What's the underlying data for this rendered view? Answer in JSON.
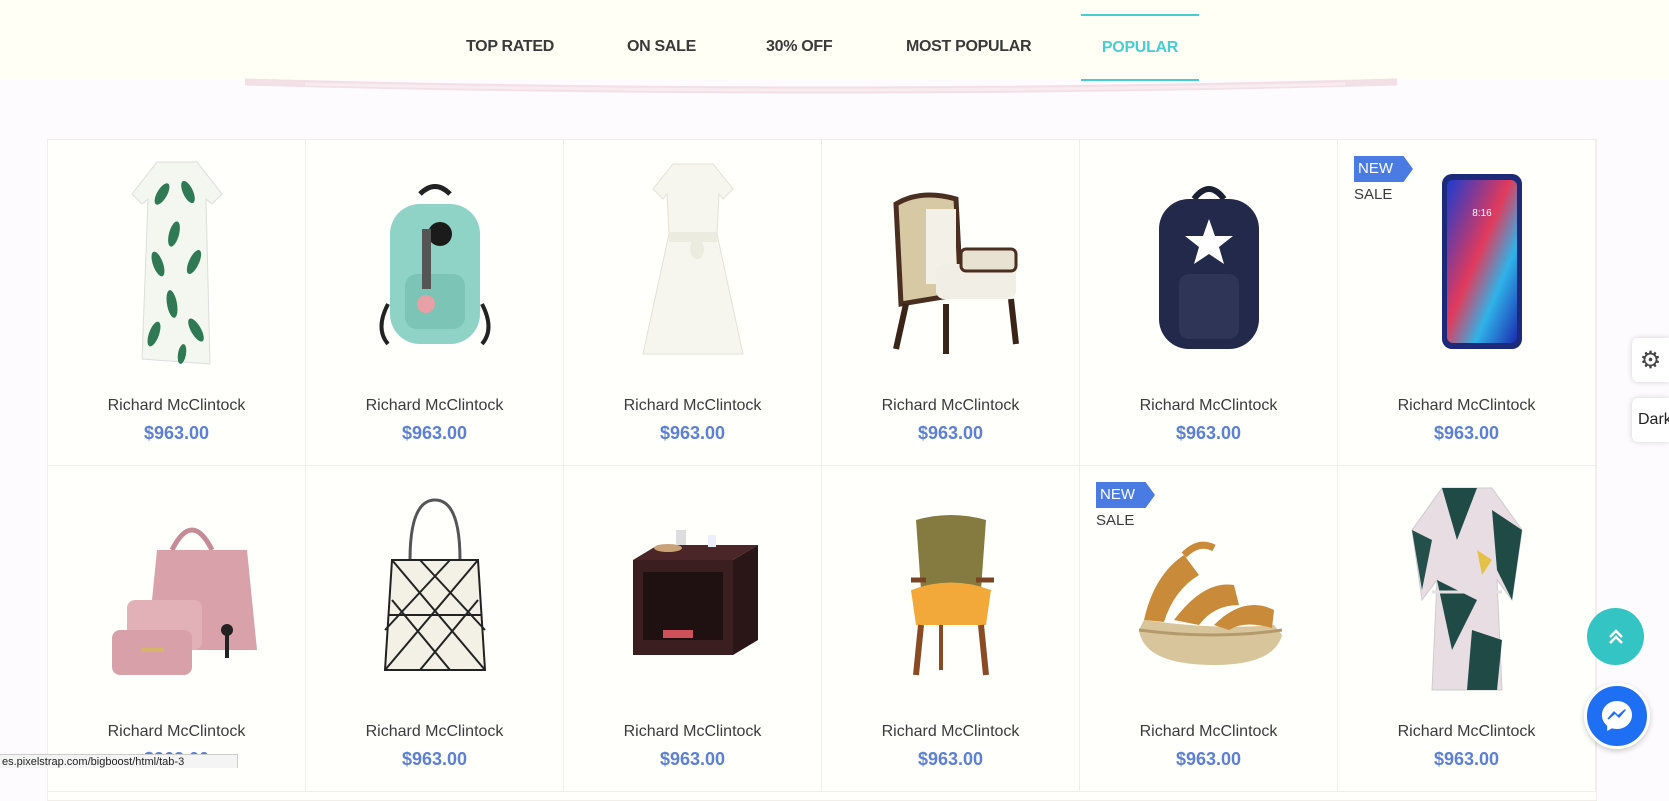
{
  "tabs": [
    {
      "label": "TOP RATED",
      "active": false
    },
    {
      "label": "ON SALE",
      "active": false
    },
    {
      "label": "30% OFF",
      "active": false
    },
    {
      "label": "MOST POPULAR",
      "active": false
    },
    {
      "label": "POPULAR",
      "active": true
    }
  ],
  "accent_color": "#45cfd3",
  "price_color": "#5b80d6",
  "products": [
    {
      "name": "Richard McClintock",
      "price": "$963.00",
      "image": "leaf-print-dress"
    },
    {
      "name": "Richard McClintock",
      "price": "$963.00",
      "image": "mint-backpack"
    },
    {
      "name": "Richard McClintock",
      "price": "$963.00",
      "image": "white-dress"
    },
    {
      "name": "Richard McClintock",
      "price": "$963.00",
      "image": "cane-armchair"
    },
    {
      "name": "Richard McClintock",
      "price": "$963.00",
      "image": "navy-star-backpack"
    },
    {
      "name": "Richard McClintock",
      "price": "$963.00",
      "image": "smartphone",
      "badge": "NEW",
      "sale": "SALE"
    },
    {
      "name": "Richard McClintock",
      "price": "$963.00",
      "image": "pink-handbag-set"
    },
    {
      "name": "Richard McClintock",
      "price": "$963.00",
      "image": "geometric-tote"
    },
    {
      "name": "Richard McClintock",
      "price": "$963.00",
      "image": "side-table"
    },
    {
      "name": "Richard McClintock",
      "price": "$963.00",
      "image": "mustard-chair"
    },
    {
      "name": "Richard McClintock",
      "price": "$963.00",
      "image": "platform-sandal",
      "badge": "NEW",
      "sale": "SALE"
    },
    {
      "name": "Richard McClintock",
      "price": "$963.00",
      "image": "abstract-print-dress"
    }
  ],
  "side_panel": {
    "gear_icon": "gear-icon",
    "dark_label": "Dark"
  },
  "status_url": "es.pixelstrap.com/bigboost/html/tab-3"
}
